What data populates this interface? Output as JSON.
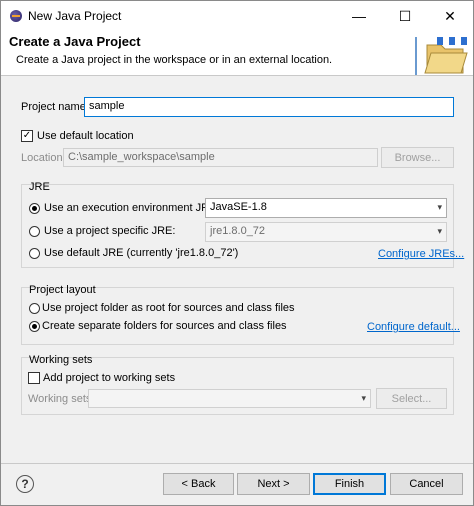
{
  "window": {
    "title": "New Java Project",
    "minimize": "—",
    "maximize": "☐",
    "close": "✕"
  },
  "header": {
    "title": "Create a Java Project",
    "description": "Create a Java project in the workspace or in an external location."
  },
  "project": {
    "name_label": "Project name:",
    "name_value": "sample",
    "use_default_location_label": "Use default location",
    "use_default_location_checked": true,
    "location_label": "Location:",
    "location_value": "C:\\sample_workspace\\sample",
    "browse_label": "Browse..."
  },
  "jre": {
    "title": "JRE",
    "opt_env_label": "Use an execution environment JRE:",
    "opt_env_value": "JavaSE-1.8",
    "opt_specific_label": "Use a project specific JRE:",
    "opt_specific_value": "jre1.8.0_72",
    "opt_default_label": "Use default JRE (currently 'jre1.8.0_72')",
    "configure_link": "Configure JREs...",
    "selected": "env"
  },
  "layout": {
    "title": "Project layout",
    "opt_root_label": "Use project folder as root for sources and class files",
    "opt_separate_label": "Create separate folders for sources and class files",
    "configure_link": "Configure default...",
    "selected": "separate"
  },
  "working_sets": {
    "title": "Working sets",
    "add_label": "Add project to working sets",
    "add_checked": false,
    "sets_label": "Working sets:",
    "sets_value": "",
    "select_label": "Select..."
  },
  "footer": {
    "help": "?",
    "back": "< Back",
    "next": "Next >",
    "finish": "Finish",
    "cancel": "Cancel"
  }
}
